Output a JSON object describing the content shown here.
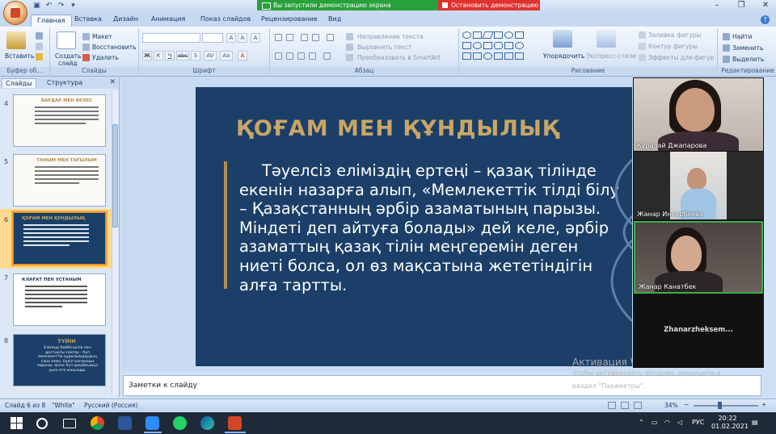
{
  "title_bar": {
    "share_status": "Вы запустили демонстрацию экрана",
    "stop_share": "Остановить демонстрацию"
  },
  "tabs": [
    "Главная",
    "Вставка",
    "Дизайн",
    "Анимация",
    "Показ слайдов",
    "Рецензирование",
    "Вид"
  ],
  "ribbon": {
    "paste": "Вставить",
    "clipboard_group": "Буфер об...",
    "new_slide_line1": "Создать",
    "new_slide_line2": "слайд",
    "layout": "Макет",
    "reset": "Восстановить",
    "delete": "Удалить",
    "slides_group": "Слайды",
    "font_group": "Шрифт",
    "font_bold": "Ж",
    "font_italic": "К",
    "font_underline": "Ч",
    "font_strike": "abc",
    "font_shadow": "S",
    "font_spacing": "AV",
    "font_case": "Аа",
    "font_color": "A",
    "font_grow": "A",
    "font_shrink": "A",
    "font_clear": "A",
    "text_direction": "Направление текста",
    "align_text": "Выровнять текст",
    "smartart": "Преобразовать в SmartArt",
    "paragraph_group": "Абзац",
    "arrange": "Упорядочить",
    "quick_styles": "Экспресс-стили",
    "shape_fill": "Заливка фигуры",
    "shape_outline": "Контур фигуры",
    "shape_effects": "Эффекты для фигур",
    "drawing_group": "Рисование",
    "find": "Найти",
    "replace": "Заменить",
    "select": "Выделить",
    "editing_group": "Редактирование"
  },
  "left_panel": {
    "tab_slides": "Слайды",
    "tab_outline": "Структура",
    "slides": [
      {
        "num": "4",
        "title": "БАҒДАР МЕН БЕЛЕС"
      },
      {
        "num": "5",
        "title": "ТАНЫМ МЕН ТАҒЫЛЫМ"
      },
      {
        "num": "6",
        "title": "ҚОҒАМ МЕН ҚҰНДЫЛЫҚ"
      },
      {
        "num": "7",
        "title": "КЛАҒАТ ПЕН ҰСТАНЫМ"
      },
      {
        "num": "8",
        "title": "ТҮЙІН"
      }
    ],
    "slide8_text": "Елімізді бейбітшілік пен достықты сақтау - бүл мемлекеттік құрылымдардың ғана емес, бүкіл қоғамның парызы, және бүл әрқайсымыз үшін өте маңызды."
  },
  "slide": {
    "title": "ҚОҒАМ МЕН ҚҰНДЫЛЫҚ",
    "body": "Тәуелсіз еліміздің ертеңі – қазақ тілінде екенін назарға алып, «Мемлекеттік тілді білу – Қазақстанның әрбір азаматының парызы. Міндеті деп айтуға болады» дей келе, әрбір азаматтың қазақ тілін меңгеремін деген ниеті болса, ол өз мақсатына жететіндігін алға тартты."
  },
  "notes_placeholder": "Заметки к слайду",
  "watermark": {
    "line1": "Активация Windows",
    "line2": "Чтобы активировать Windows, перейдите в",
    "line3": "раздел \"Параметры\"."
  },
  "status_bar": {
    "slide_counter": "Слайд 6 из 8",
    "theme": "\"White\"",
    "language": "Русский (Россия)",
    "zoom": "34%"
  },
  "participants": [
    {
      "name": "Куралай Джапарова"
    },
    {
      "name": "Жанар Инкарбаева"
    },
    {
      "name": "Жанар Канатбек"
    },
    {
      "name": "Zhanarzheksem..."
    }
  ],
  "taskbar": {
    "language": "РУС",
    "time": "20:22",
    "date": "01.02.2021"
  },
  "colors": {
    "slide_bg": "#1b3f68",
    "slide_title": "#c9a665",
    "share_green": "#27a13a",
    "share_red": "#e0312f"
  }
}
